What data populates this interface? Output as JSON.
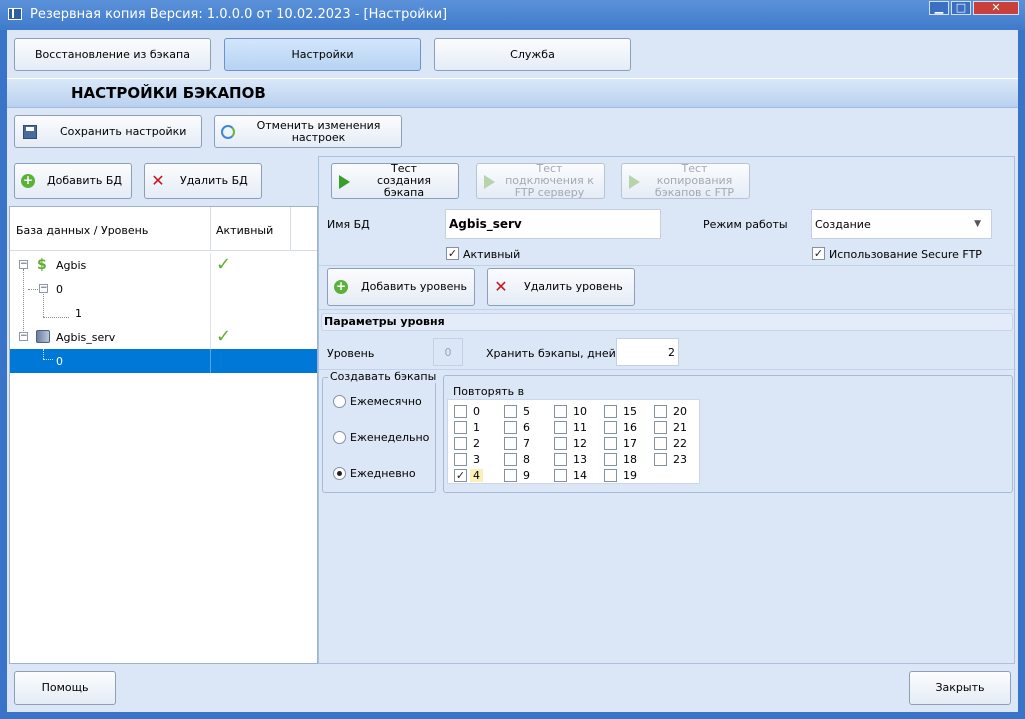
{
  "window": {
    "title": "Резервная копия   Версия: 1.0.0.0 от 10.02.2023 - [Настройки]",
    "minimize": "▁",
    "maximize": "□",
    "close": "✕"
  },
  "tabs": [
    {
      "label": "Восстановление из бэкапа",
      "selected": false
    },
    {
      "label": "Настройки",
      "selected": true
    },
    {
      "label": "Служба",
      "selected": false
    }
  ],
  "section": {
    "title": "НАСТРОЙКИ БЭКАПОВ"
  },
  "toolbar": {
    "save_label": "Сохранить настройки",
    "revert_label": "Отменить изменения настроек"
  },
  "db_actions": {
    "add_label": "Добавить БД",
    "delete_label": "Удалить БД"
  },
  "tree": {
    "col_name": "База данных / Уровень",
    "col_active": "Активный",
    "rows": [
      {
        "name": "Agbis",
        "active": true
      },
      {
        "name": "0",
        "active": false
      },
      {
        "name": "1",
        "active": false
      },
      {
        "name": "Agbis_serv",
        "active": true
      },
      {
        "name": "0",
        "active": false,
        "selected": true
      }
    ]
  },
  "tests": {
    "create": "Тест создания бэкапа",
    "ftp_connect": "Тест подключения к FTP серверу",
    "ftp_copy": "Тест копирования бэкапов с FTP"
  },
  "db_form": {
    "name_label": "Имя БД",
    "name_value": "Agbis_serv",
    "mode_label": "Режим работы",
    "mode_value": "Создание",
    "active_label": "Активный",
    "active_checked": true,
    "sftp_label": "Использование Secure FTP",
    "sftp_checked": true
  },
  "level_actions": {
    "add_label": "Добавить уровень",
    "delete_label": "Удалить уровень"
  },
  "level": {
    "header": "Параметры уровня",
    "level_label": "Уровень",
    "level_value": "0",
    "keep_label": "Хранить бэкапы, дней",
    "keep_value": "2",
    "create_group": "Создавать бэкапы",
    "freq": [
      {
        "label": "Ежемесячно",
        "checked": false
      },
      {
        "label": "Еженедельно",
        "checked": false
      },
      {
        "label": "Ежедневно",
        "checked": true
      }
    ],
    "repeat_group": "Повторять в",
    "hours": [
      "0",
      "1",
      "2",
      "3",
      "4",
      "5",
      "6",
      "7",
      "8",
      "9",
      "10",
      "11",
      "12",
      "13",
      "14",
      "15",
      "16",
      "17",
      "18",
      "19",
      "20",
      "21",
      "22",
      "23"
    ],
    "checked_hour": "4"
  },
  "footer": {
    "help_label": "Помощь",
    "close_label": "Закрыть"
  },
  "colors": {
    "title_bar": "#3f7acb",
    "selection": "#0078d7",
    "check": "#5fae2e",
    "highlight": "#fbefb8"
  }
}
